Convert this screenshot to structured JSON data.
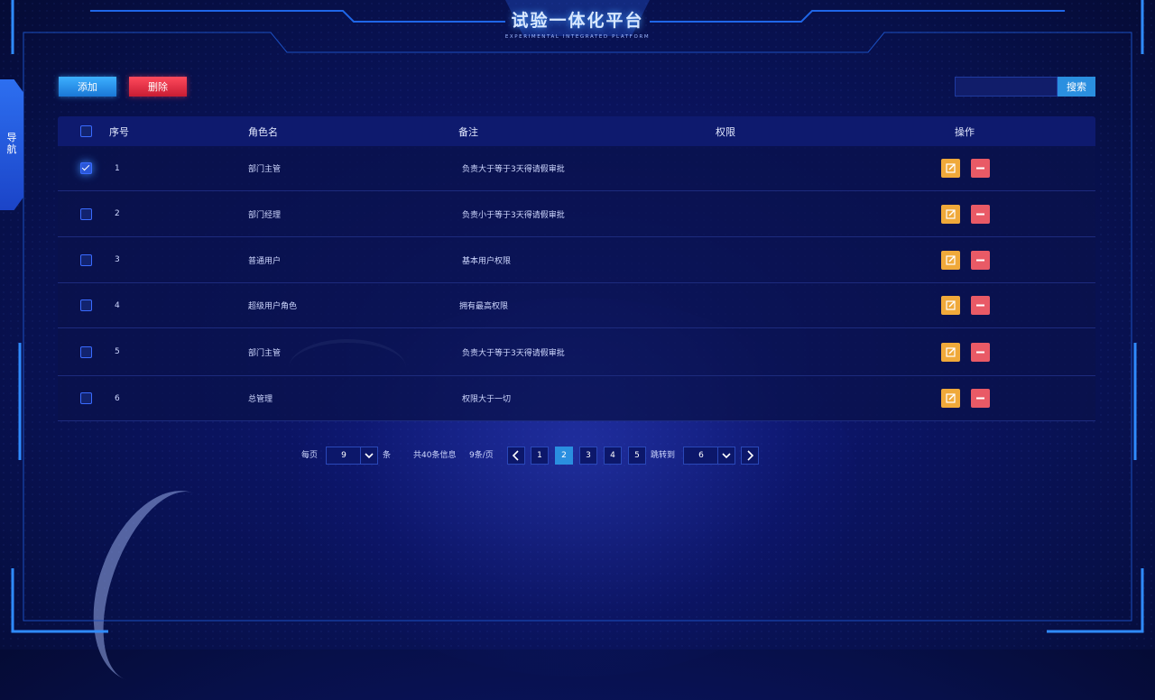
{
  "header": {
    "title": "试验一体化平台",
    "subtitle": "EXPERIMENTAL INTEGRATED PLATFORM"
  },
  "side_nav": {
    "label": "导航"
  },
  "toolbar": {
    "add_label": "添加",
    "delete_label": "删除",
    "search_value": "",
    "search_placeholder": "",
    "search_label": "搜索"
  },
  "table": {
    "columns": [
      "序号",
      "角色名",
      "备注",
      "权限",
      "操作"
    ],
    "rows": [
      {
        "index": "1",
        "role": "部门主管",
        "note": "负责大于等于3天得请假审批",
        "permission": "",
        "checked": true
      },
      {
        "index": "2",
        "role": "部门经理",
        "note": "负责小于等于3天得请假审批",
        "permission": "",
        "checked": false
      },
      {
        "index": "3",
        "role": "普通用户",
        "note": "基本用户权限",
        "permission": "",
        "checked": false
      },
      {
        "index": "4",
        "role": "超级用户角色",
        "note": "拥有最高权限",
        "permission": "",
        "checked": false
      },
      {
        "index": "5",
        "role": "部门主管",
        "note": "负责大于等于3天得请假审批",
        "permission": "",
        "checked": false
      },
      {
        "index": "6",
        "role": "总管理",
        "note": "权限大于一切",
        "permission": "",
        "checked": false
      }
    ]
  },
  "pagination": {
    "per_page_prefix": "每页",
    "per_page_value": "9",
    "per_page_suffix": "条",
    "total_info": "共40条信息",
    "page_size_info": "9条/页",
    "pages": [
      "1",
      "2",
      "3",
      "4",
      "5"
    ],
    "current_page": "2",
    "jump_label": "跳转到",
    "jump_value": "6"
  },
  "colors": {
    "accent": "#2a8fe0",
    "danger": "#e0263a",
    "edit": "#f0a93a",
    "remove": "#e95a66",
    "background": "#0b1463"
  },
  "icons": {
    "edit": "edit-icon",
    "remove": "minus-icon",
    "prev": "chevron-left-icon",
    "next": "chevron-right-icon",
    "dropdown": "chevron-down-icon"
  }
}
